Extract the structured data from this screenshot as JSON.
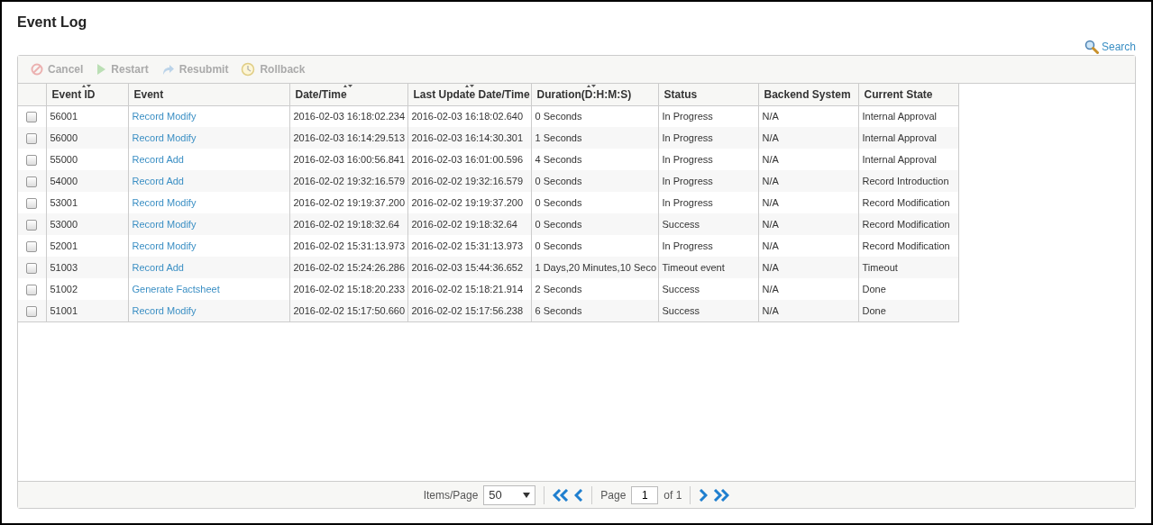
{
  "title": "Event Log",
  "search": {
    "label": "Search"
  },
  "toolbar": [
    {
      "label": "Cancel",
      "kind": "cancel",
      "disabled": true
    },
    {
      "label": "Restart",
      "kind": "restart",
      "disabled": true
    },
    {
      "label": "Resubmit",
      "kind": "resubmit",
      "disabled": true
    },
    {
      "label": "Rollback",
      "kind": "rollback",
      "disabled": true
    }
  ],
  "table": {
    "columns": [
      {
        "label": "Event ID",
        "sort_arrows": true
      },
      {
        "label": "Event",
        "sort_arrows": false
      },
      {
        "label": "Date/Time",
        "sort_arrows": true
      },
      {
        "label": "Last Update Date/Time",
        "sort_arrows": true
      },
      {
        "label": "Duration(D:H:M:S)",
        "sort_arrows": true
      },
      {
        "label": "Status",
        "sort_arrows": false
      },
      {
        "label": "Backend System",
        "sort_arrows": false
      },
      {
        "label": "Current State",
        "sort_arrows": false
      }
    ],
    "rows": [
      {
        "checked": false,
        "cells": [
          "56001",
          "Record Modify",
          "2016-02-03 16:18:02.234",
          "2016-02-03 16:18:02.640",
          "0 Seconds",
          "In Progress",
          "N/A",
          "Internal Approval"
        ]
      },
      {
        "checked": false,
        "cells": [
          "56000",
          "Record Modify",
          "2016-02-03 16:14:29.513",
          "2016-02-03 16:14:30.301",
          "1 Seconds",
          "In Progress",
          "N/A",
          "Internal Approval"
        ]
      },
      {
        "checked": false,
        "cells": [
          "55000",
          "Record Add",
          "2016-02-03 16:00:56.841",
          "2016-02-03 16:01:00.596",
          "4 Seconds",
          "In Progress",
          "N/A",
          "Internal Approval"
        ]
      },
      {
        "checked": false,
        "cells": [
          "54000",
          "Record Add",
          "2016-02-02 19:32:16.579",
          "2016-02-02 19:32:16.579",
          "0 Seconds",
          "In Progress",
          "N/A",
          "Record Introduction"
        ]
      },
      {
        "checked": false,
        "cells": [
          "53001",
          "Record Modify",
          "2016-02-02 19:19:37.200",
          "2016-02-02 19:19:37.200",
          "0 Seconds",
          "In Progress",
          "N/A",
          "Record Modification"
        ]
      },
      {
        "checked": false,
        "cells": [
          "53000",
          "Record Modify",
          "2016-02-02 19:18:32.64",
          "2016-02-02 19:18:32.64",
          "0 Seconds",
          "Success",
          "N/A",
          "Record Modification"
        ]
      },
      {
        "checked": false,
        "cells": [
          "52001",
          "Record Modify",
          "2016-02-02 15:31:13.973",
          "2016-02-02 15:31:13.973",
          "0 Seconds",
          "In Progress",
          "N/A",
          "Record Modification"
        ]
      },
      {
        "checked": false,
        "cells": [
          "51003",
          "Record Add",
          "2016-02-02 15:24:26.286",
          "2016-02-03 15:44:36.652",
          "1 Days,20 Minutes,10 Seco",
          "Timeout event",
          "N/A",
          "Timeout"
        ]
      },
      {
        "checked": false,
        "cells": [
          "51002",
          "Generate Factsheet",
          "2016-02-02 15:18:20.233",
          "2016-02-02 15:18:21.914",
          "2 Seconds",
          "Success",
          "N/A",
          "Done"
        ]
      },
      {
        "checked": false,
        "cells": [
          "51001",
          "Record Modify",
          "2016-02-02 15:17:50.660",
          "2016-02-02 15:17:56.238",
          "6 Seconds",
          "Success",
          "N/A",
          "Done"
        ]
      }
    ]
  },
  "pager": {
    "items_label": "Items/Page",
    "items_value": "50",
    "page_label": "Page",
    "page_value": "1",
    "of_label": "of 1"
  }
}
